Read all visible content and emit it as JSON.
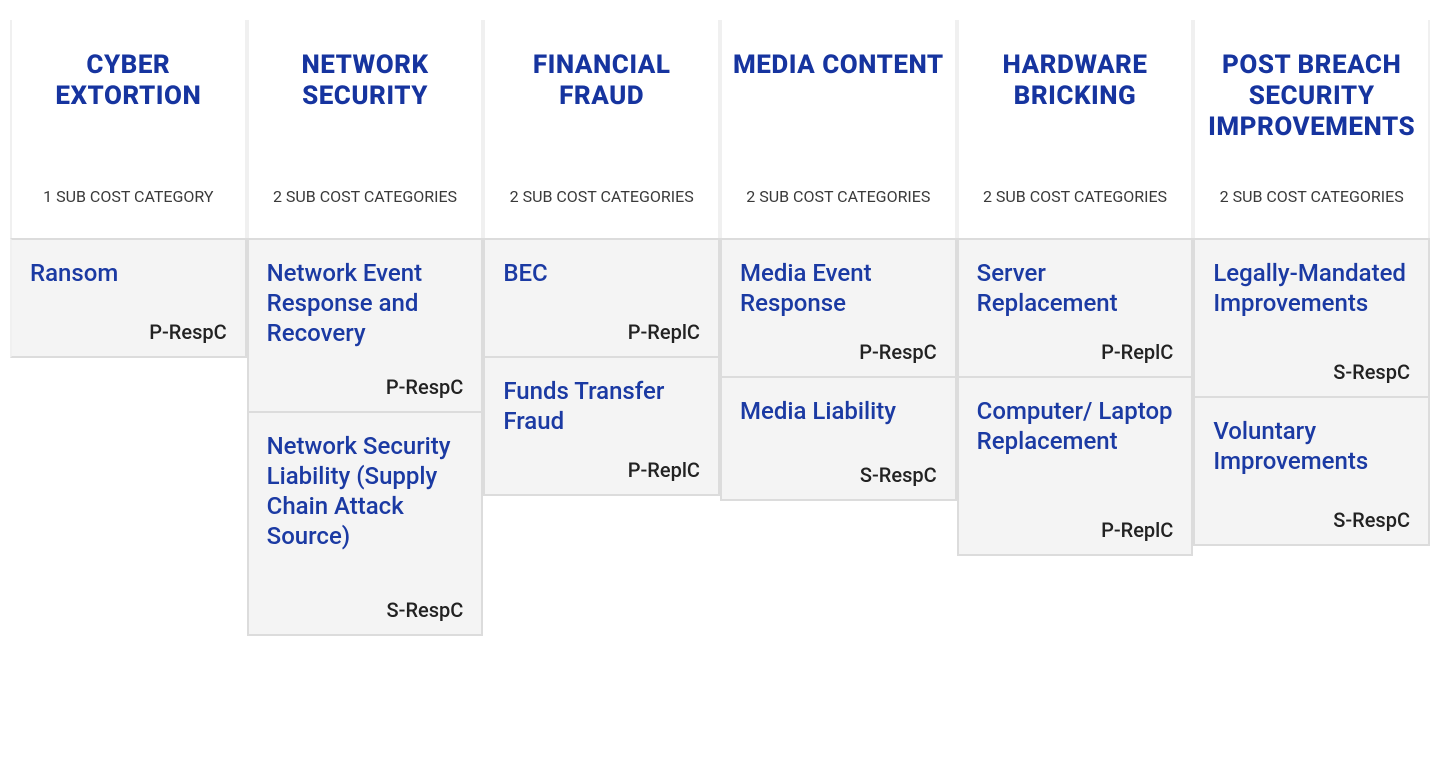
{
  "columns": [
    {
      "title": "CYBER EXTORTION",
      "sub": "1 SUB COST CATEGORY",
      "cards": [
        {
          "title": "Ransom",
          "tag": "P-RespC"
        }
      ]
    },
    {
      "title": "NETWORK SECURITY",
      "sub": "2 SUB COST CATEGORIES",
      "cards": [
        {
          "title": "Network Event Response and Recovery",
          "tag": "P-RespC"
        },
        {
          "title": "Network Security Liability (Supply Chain Attack Source)",
          "tag": "S-RespC"
        }
      ]
    },
    {
      "title": "FINANCIAL FRAUD",
      "sub": "2 SUB COST CATEGORIES",
      "cards": [
        {
          "title": "BEC",
          "tag": "P-ReplC"
        },
        {
          "title": "Funds Transfer Fraud",
          "tag": "P-ReplC"
        }
      ]
    },
    {
      "title": "MEDIA CONTENT",
      "sub": "2 SUB COST CATEGORIES",
      "cards": [
        {
          "title": "Media Event Response",
          "tag": "P-RespC"
        },
        {
          "title": "Media Liability",
          "tag": "S-RespC"
        }
      ]
    },
    {
      "title": "HARDWARE BRICKING",
      "sub": "2 SUB COST CATEGORIES",
      "cards": [
        {
          "title": "Server Replacement",
          "tag": "P-ReplC"
        },
        {
          "title": "Computer/ Laptop Replacement",
          "tag": "P-ReplC"
        }
      ]
    },
    {
      "title": "POST BREACH SECURITY IMPROVEMENTS",
      "sub": "2 SUB COST CATEGORIES",
      "cards": [
        {
          "title": "Legally-Mandated Improvements",
          "tag": "S-RespC"
        },
        {
          "title": "Voluntary Improvements",
          "tag": "S-RespC"
        }
      ]
    }
  ]
}
